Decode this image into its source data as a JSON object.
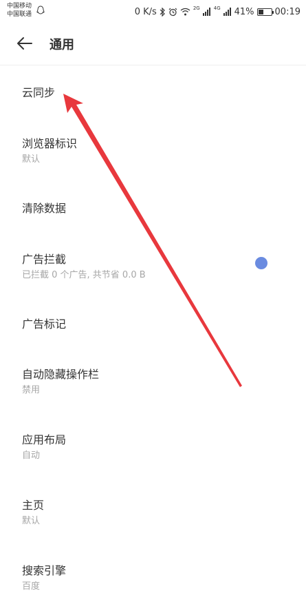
{
  "status_bar": {
    "carrier_1": "中国移动",
    "carrier_2": "中国联通",
    "net_speed": "0 K/s",
    "sim1_net": "2G",
    "sim2_net": "4G",
    "battery": "41%",
    "battery_level": 0.41,
    "time": "00:19"
  },
  "header": {
    "back_icon": "arrow-left-icon",
    "title": "通用"
  },
  "settings": [
    {
      "label": "云同步",
      "sub": ""
    },
    {
      "label": "浏览器标识",
      "sub": "默认"
    },
    {
      "label": "清除数据",
      "sub": ""
    },
    {
      "label": "广告拦截",
      "sub": "已拦截 0 个广告, 共节省 0.0 B"
    },
    {
      "label": "广告标记",
      "sub": ""
    },
    {
      "label": "自动隐藏操作栏",
      "sub": "禁用"
    },
    {
      "label": "应用布局",
      "sub": "自动"
    },
    {
      "label": "主页",
      "sub": "默认"
    },
    {
      "label": "搜索引擎",
      "sub": "百度"
    }
  ],
  "colors": {
    "accent_dot": "#6a8be0",
    "annotation_arrow": "#e8383d"
  }
}
